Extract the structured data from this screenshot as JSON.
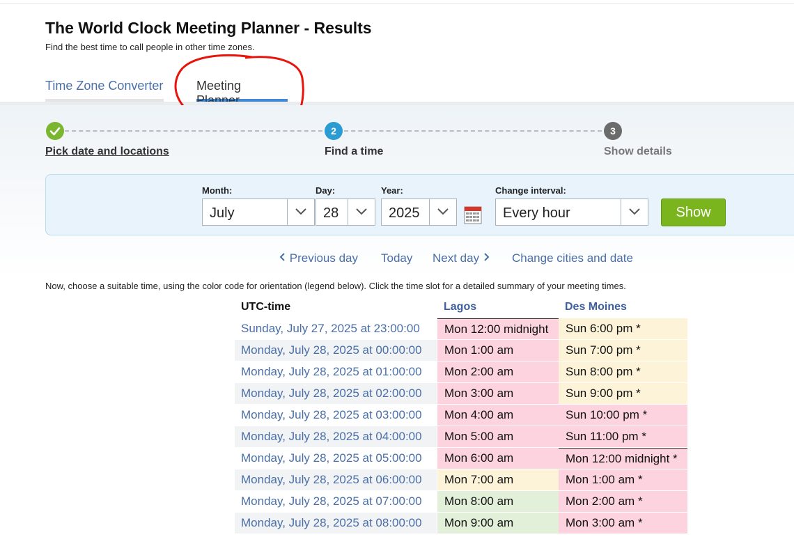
{
  "page": {
    "title": "The World Clock Meeting Planner - Results",
    "subtitle": "Find the best time to call people in other time zones."
  },
  "tabs": [
    {
      "label": "Time Zone Converter"
    },
    {
      "label": "Meeting Planner"
    }
  ],
  "steps": [
    {
      "number": "",
      "label": "Pick date and locations",
      "status": "done",
      "icon": "check-icon"
    },
    {
      "number": "2",
      "label": "Find a time",
      "status": "current"
    },
    {
      "number": "3",
      "label": "Show details",
      "status": "upcoming"
    }
  ],
  "form": {
    "month_label": "Month:",
    "month_value": "July",
    "day_label": "Day:",
    "day_value": "28",
    "year_label": "Year:",
    "year_value": "2025",
    "interval_label": "Change interval:",
    "interval_value": "Every hour",
    "show_label": "Show",
    "calendar_icon": "calendar-icon"
  },
  "nav": {
    "previous": "Previous day",
    "today": "Today",
    "next": "Next day",
    "change": "Change cities and date"
  },
  "instructions": "Now, choose a suitable time, using the color code for orientation (legend below). Click the time slot for a detailed summary of your meeting times.",
  "table": {
    "headers": {
      "utc": "UTC-time",
      "city1": "Lagos",
      "city2": "Des Moines"
    },
    "rows": [
      {
        "utc": "Sunday, July 27, 2025 at 23:00:00",
        "lagos": "Mon 12:00 midnight",
        "dm": "Sun 6:00 pm *"
      },
      {
        "utc": "Monday, July 28, 2025 at 00:00:00",
        "lagos": "Mon 1:00 am",
        "dm": "Sun 7:00 pm *"
      },
      {
        "utc": "Monday, July 28, 2025 at 01:00:00",
        "lagos": "Mon 2:00 am",
        "dm": "Sun 8:00 pm *"
      },
      {
        "utc": "Monday, July 28, 2025 at 02:00:00",
        "lagos": "Mon 3:00 am",
        "dm": "Sun 9:00 pm *"
      },
      {
        "utc": "Monday, July 28, 2025 at 03:00:00",
        "lagos": "Mon 4:00 am",
        "dm": "Sun 10:00 pm *"
      },
      {
        "utc": "Monday, July 28, 2025 at 04:00:00",
        "lagos": "Mon 5:00 am",
        "dm": "Sun 11:00 pm *"
      },
      {
        "utc": "Monday, July 28, 2025 at 05:00:00",
        "lagos": "Mon 6:00 am",
        "dm": "Mon 12:00 midnight *"
      },
      {
        "utc": "Monday, July 28, 2025 at 06:00:00",
        "lagos": "Mon 7:00 am",
        "dm": "Mon 1:00 am *"
      },
      {
        "utc": "Monday, July 28, 2025 at 07:00:00",
        "lagos": "Mon 8:00 am",
        "dm": "Mon 2:00 am *"
      },
      {
        "utc": "Monday, July 28, 2025 at 08:00:00",
        "lagos": "Mon 9:00 am",
        "dm": "Mon 3:00 am *"
      }
    ]
  },
  "colors": {
    "link": "#4a6fa8",
    "night": "#fcd3de",
    "evening": "#fdf3d8",
    "day": "#e2efd9",
    "utc_alt_row": "#f1f3f5",
    "show_button": "#7ab51d",
    "active_tab_underline": "#3f8ad8",
    "annotation_circle": "#e8140c"
  }
}
